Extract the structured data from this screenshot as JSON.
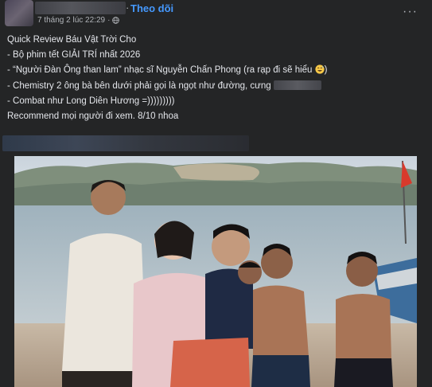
{
  "header": {
    "follow_label": "Theo dõi",
    "separator": "·",
    "timestamp": "7 tháng 2 lúc 22:29",
    "meta_separator": "·",
    "more_label": "···",
    "close_label": "✕"
  },
  "post": {
    "lines": [
      "Quick Review Báu Vật Trời Cho",
      "- Bộ phim tết GIẢI TRÍ nhất 2026",
      "- “Người Đàn Ông than lam” nhạc sĩ Nguyễn Chấn Phong (ra rạp đi sẽ hiểu ",
      "- Chemistry 2 ông bà bên dưới phải gọi là ngọt như đường, cưng ",
      "- Combat như Long Diên Hương =)))))))))",
      "Recommend mọi người đi xem. 8/10 nhoa"
    ],
    "line3_suffix": ")"
  },
  "colors": {
    "background": "#242526",
    "text": "#e4e6eb",
    "secondary": "#b0b3b8",
    "link": "#4599ff"
  },
  "icons": [
    "globe-icon",
    "more-icon",
    "close-icon",
    "grinning-sweat-emoji"
  ]
}
